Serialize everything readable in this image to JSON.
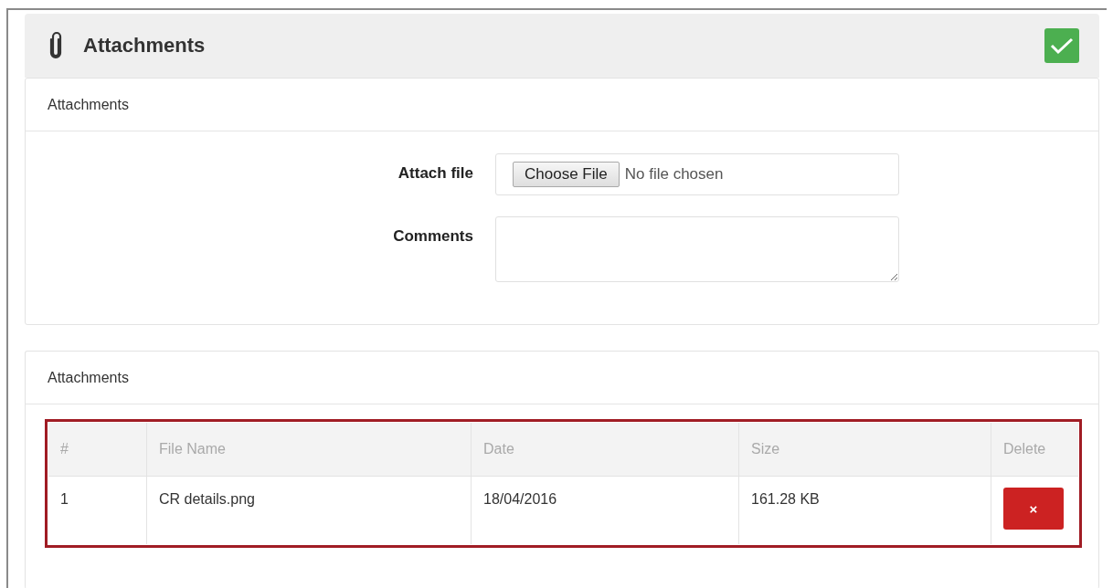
{
  "header": {
    "title": "Attachments"
  },
  "upload_panel": {
    "title": "Attachments",
    "attach_label": "Attach file",
    "choose_button": "Choose File",
    "file_status": "No file chosen",
    "comments_label": "Comments"
  },
  "list_panel": {
    "title": "Attachments",
    "table": {
      "columns": [
        "#",
        "File Name",
        "Date",
        "Size",
        "Delete"
      ],
      "rows": [
        {
          "number": "1",
          "file_name": "CR details.png",
          "date": "18/04/2016",
          "size": "161.28 KB",
          "delete": "×"
        }
      ]
    }
  }
}
